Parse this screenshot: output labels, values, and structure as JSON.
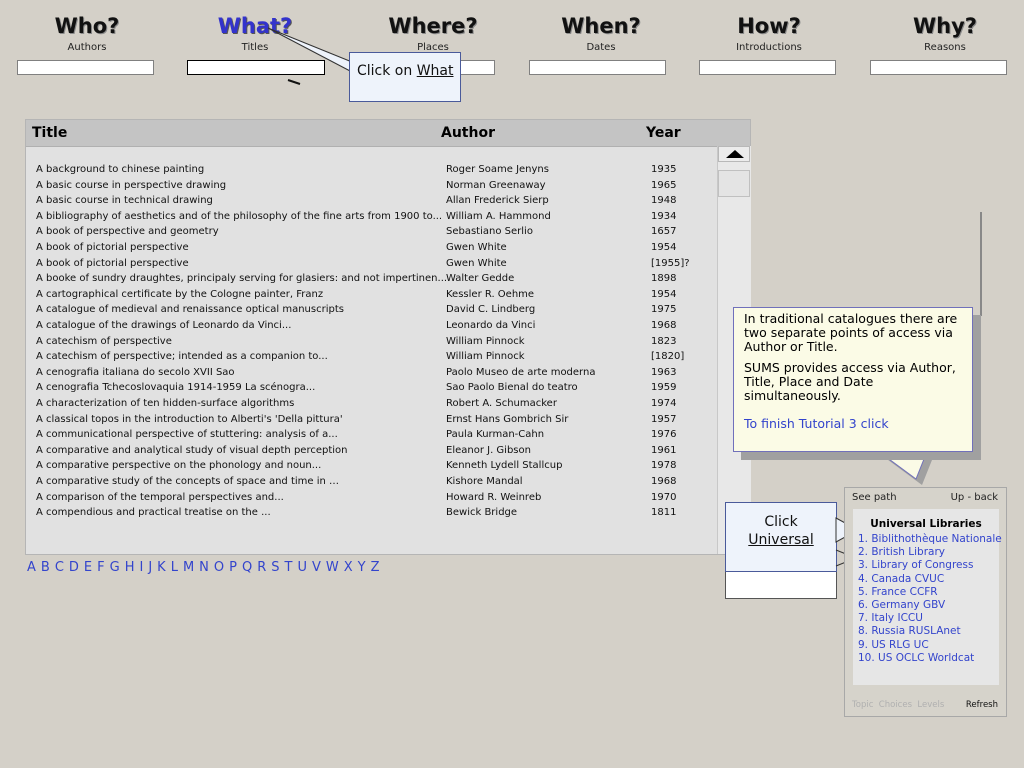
{
  "questions": [
    {
      "big": "Who?",
      "sub": "Authors"
    },
    {
      "big": "What?",
      "sub": "Titles"
    },
    {
      "big": "Where?",
      "sub": "Places"
    },
    {
      "big": "When?",
      "sub": "Dates"
    },
    {
      "big": "How?",
      "sub": "Introductions"
    },
    {
      "big": "Why?",
      "sub": "Reasons"
    }
  ],
  "callout_what": {
    "prefix": "Click on ",
    "link": "What"
  },
  "results": {
    "headers": {
      "title": "Title",
      "author": "Author",
      "year": "Year"
    },
    "rows": [
      {
        "title": "A background to chinese painting",
        "author": "Roger Soame Jenyns",
        "year": "1935"
      },
      {
        "title": "A basic course in perspective drawing",
        "author": "Norman Greenaway",
        "year": "1965"
      },
      {
        "title": "A basic course in technical drawing",
        "author": "Allan Frederick Sierp",
        "year": "1948"
      },
      {
        "title": "A bibliography of aesthetics and of the philosophy of the fine arts from 1900 to...",
        "author": "William A. Hammond",
        "year": "1934"
      },
      {
        "title": "A book of perspective and geometry",
        "author": "Sebastiano Serlio",
        "year": "1657"
      },
      {
        "title": "A book of pictorial perspective",
        "author": "Gwen White",
        "year": "1954"
      },
      {
        "title": "A book of pictorial perspective",
        "author": "Gwen White",
        "year": "[1955]?"
      },
      {
        "title": "A booke of sundry draughtes, principaly serving for glasiers: and not impertinen...",
        "author": "Walter Gedde",
        "year": "1898"
      },
      {
        "title": "A cartographical certificate by the Cologne painter, Franz",
        "author": "Kessler R. Oehme",
        "year": "1954"
      },
      {
        "title": "A catalogue of medieval and renaissance optical manuscripts",
        "author": "David C. Lindberg",
        "year": "1975"
      },
      {
        "title": "A catalogue of the drawings of Leonardo da Vinci...",
        "author": "Leonardo da Vinci",
        "year": "1968"
      },
      {
        "title": "A catechism of perspective",
        "author": "William Pinnock",
        "year": "1823"
      },
      {
        "title": "A catechism of perspective; intended as a companion to...",
        "author": "William Pinnock",
        "year": "[1820]"
      },
      {
        "title": "A cenografia italiana do secolo XVII Sao",
        "author": "Paolo Museo de arte moderna",
        "year": "1963"
      },
      {
        "title": "A cenografia Tchecoslovaquia 1914-1959 La scénogra...",
        "author": "Sao Paolo Bienal do teatro",
        "year": "1959"
      },
      {
        "title": "A characterization of ten hidden-surface algorithms",
        "author": "Robert A. Schumacker",
        "year": "1974"
      },
      {
        "title": "A classical topos in the introduction to Alberti's 'Della pittura'",
        "author": "Ernst Hans Gombrich Sir",
        "year": "1957"
      },
      {
        "title": "A communicational perspective of stuttering: analysis of a...",
        "author": "Paula Kurman-Cahn",
        "year": "1976"
      },
      {
        "title": "A comparative and analytical study of visual depth perception",
        "author": "Eleanor J. Gibson",
        "year": "1961"
      },
      {
        "title": "A comparative perspective on the phonology and noun...",
        "author": "Kenneth Lydell Stallcup",
        "year": "1978"
      },
      {
        "title": "A comparative study of the concepts of space and time in …",
        "author": "Kishore Mandal",
        "year": "1968"
      },
      {
        "title": "A comparison of the temporal perspectives and...",
        "author": "Howard R. Weinreb",
        "year": "1970"
      },
      {
        "title": "A compendious and practical treatise on the ...",
        "author": "Bewick Bridge",
        "year": "1811"
      }
    ]
  },
  "alphabet": [
    "A",
    "B",
    "C",
    "D",
    "E",
    "F",
    "G",
    "H",
    "I",
    "J",
    "K",
    "L",
    "M",
    "N",
    "O",
    "P",
    "Q",
    "R",
    "S",
    "T",
    "U",
    "V",
    "W",
    "X",
    "Y",
    "Z"
  ],
  "info": {
    "p1": "In traditional catalogues there are two separate points of access via Author or Title.",
    "p2": "SUMS provides access via Author, Title, Place and Date simultaneously.",
    "link": "To finish Tutorial 3 click"
  },
  "callout_universal": {
    "line1": "Click",
    "line2": "Universal"
  },
  "libraries": {
    "see_path": "See path",
    "up_back": "Up - back",
    "title": "Universal Libraries",
    "items": [
      "1. Biblithothèque Nationale",
      "2. British Library",
      "3. Library of Congress",
      "4. Canada CVUC",
      "5. France CCFR",
      "6. Germany GBV",
      "7. Italy ICCU",
      "8. Russia RUSLAnet",
      "9. US RLG UC",
      "10. US OCLC Worldcat"
    ],
    "footer_items": [
      "Topic",
      "Choices",
      "Levels"
    ],
    "refresh": "Refresh"
  }
}
